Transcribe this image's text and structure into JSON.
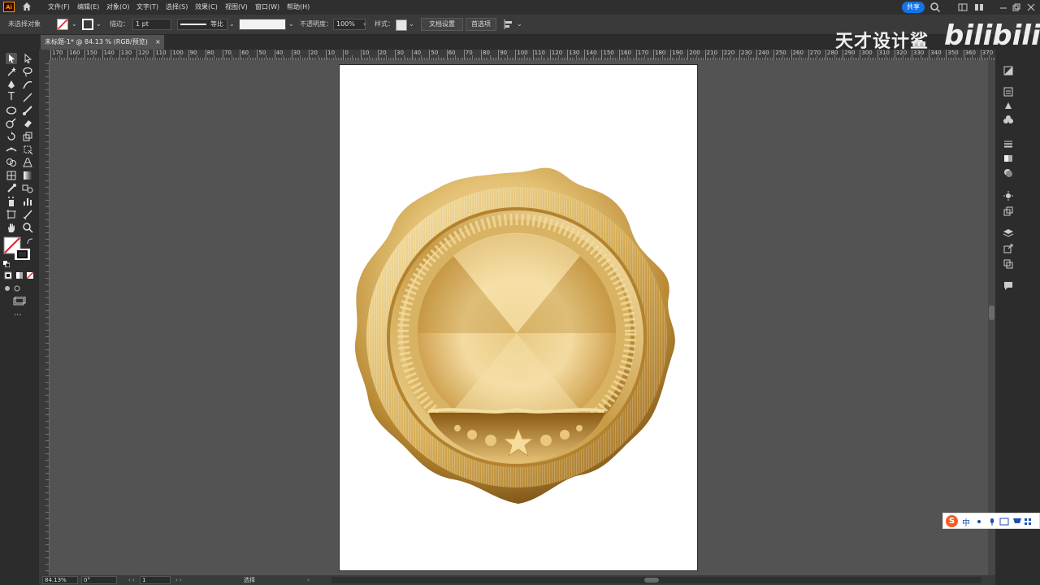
{
  "app": {
    "logo_text": "Ai"
  },
  "menu": {
    "items": [
      "文件(F)",
      "编辑(E)",
      "对象(O)",
      "文字(T)",
      "选择(S)",
      "效果(C)",
      "视图(V)",
      "窗口(W)",
      "帮助(H)"
    ],
    "share_label": "共享"
  },
  "control_bar": {
    "selection_status": "未选择对象",
    "stroke_label": "描边：",
    "stroke_weight": "1 pt",
    "stroke_profile": "等比",
    "opacity_label": "不透明度：",
    "opacity_value": "100%",
    "style_label": "样式：",
    "doc_setup_button": "文档设置",
    "preferences_button": "首选项"
  },
  "tab": {
    "title": "未标题-1* @ 84.13 % (RGB/预览)",
    "close": "×"
  },
  "ruler": {
    "h_labels": [
      "170",
      "160",
      "150",
      "140",
      "130",
      "120",
      "110",
      "100",
      "90",
      "80",
      "70",
      "60",
      "50",
      "40",
      "30",
      "20",
      "10",
      "0",
      "10",
      "20",
      "30",
      "40",
      "50",
      "60",
      "70",
      "80",
      "90",
      "100",
      "110",
      "120",
      "130",
      "140",
      "150",
      "160",
      "170",
      "180",
      "190",
      "200",
      "210",
      "220",
      "230",
      "240",
      "250",
      "260",
      "270",
      "280",
      "290",
      "300",
      "310",
      "320",
      "330",
      "340",
      "350",
      "360",
      "370"
    ]
  },
  "status_bar": {
    "zoom": "84.13%",
    "rotation": "0°",
    "artboard_number": "1",
    "tool_name": "选择"
  },
  "watermark": {
    "text": "天才设计鲨",
    "logo": "bilibili"
  },
  "ime": {
    "lang": "中"
  },
  "colors": {
    "accent": "#1473e6",
    "gold_light": "#f6e3a8",
    "gold_mid": "#d9b35c",
    "gold_dark": "#8a5a14"
  }
}
